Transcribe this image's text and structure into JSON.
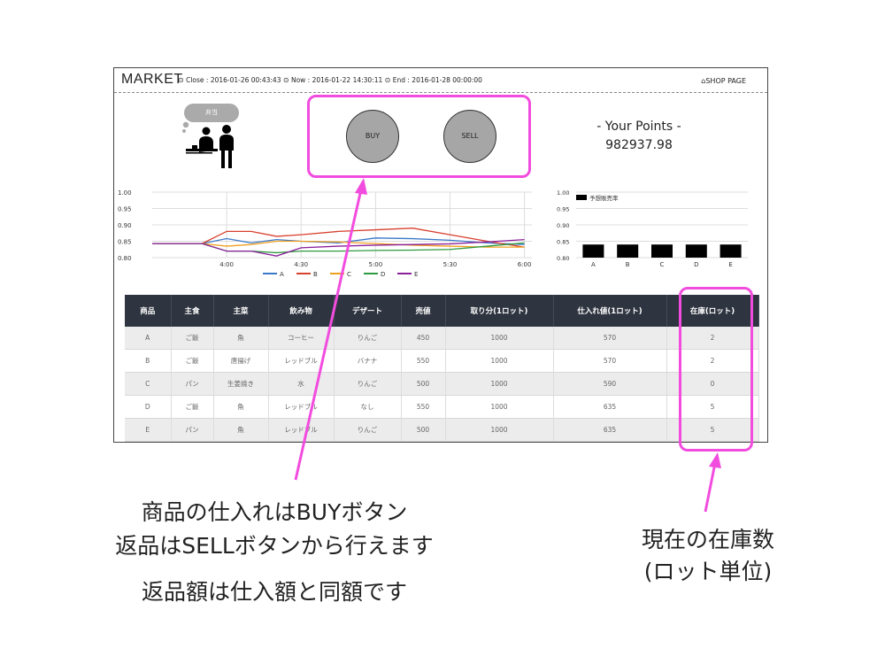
{
  "header": {
    "brand": "MARKET",
    "close": "Close : 2016-01-26 00:43:43",
    "now": "Now : 2016-01-22 14:30:11",
    "end": "End : 2016-01-28 00:00:00",
    "shop_link": "SHOP PAGE",
    "shop_icon": "home-icon",
    "clock_icon": "clock-icon"
  },
  "scene": {
    "bubble_text": "弁当"
  },
  "actions": {
    "buy_label": "BUY",
    "sell_label": "SELL"
  },
  "points": {
    "title": "- Your Points -",
    "value": "982937.98"
  },
  "chart_data": [
    {
      "type": "line",
      "x_ticks": [
        "4:00",
        "4:30",
        "5:00",
        "5:30",
        "6:00"
      ],
      "y_ticks": [
        "0.80",
        "0.85",
        "0.90",
        "0.95",
        "1.00"
      ],
      "ylim": [
        0.8,
        1.0
      ],
      "grid": true,
      "legend": "bottom",
      "x": [
        0,
        0.33,
        0.5,
        0.67,
        1.0,
        1.33,
        1.67,
        2.0,
        2.5,
        3.0,
        3.5,
        4.0,
        4.5,
        5.0
      ],
      "series": [
        {
          "name": "A",
          "color": "#3a78c8",
          "values": [
            0.843,
            0.843,
            0.843,
            0.843,
            0.858,
            0.845,
            0.855,
            0.85,
            0.845,
            0.86,
            0.858,
            0.853,
            0.845,
            0.84
          ]
        },
        {
          "name": "B",
          "color": "#d8402e",
          "values": [
            0.843,
            0.843,
            0.843,
            0.843,
            0.88,
            0.88,
            0.865,
            0.87,
            0.88,
            0.885,
            0.89,
            0.87,
            0.85,
            0.832
          ]
        },
        {
          "name": "C",
          "color": "#f0a020",
          "values": [
            0.843,
            0.843,
            0.843,
            0.843,
            0.835,
            0.84,
            0.85,
            0.85,
            0.848,
            0.843,
            0.838,
            0.835,
            0.832,
            0.832
          ]
        },
        {
          "name": "D",
          "color": "#2e9a40",
          "values": [
            0.843,
            0.843,
            0.843,
            0.843,
            0.82,
            0.82,
            0.815,
            0.82,
            0.82,
            0.822,
            0.823,
            0.825,
            0.835,
            0.845
          ]
        },
        {
          "name": "E",
          "color": "#8a1f9a",
          "values": [
            0.843,
            0.843,
            0.843,
            0.843,
            0.82,
            0.82,
            0.805,
            0.83,
            0.835,
            0.838,
            0.84,
            0.842,
            0.848,
            0.855
          ]
        }
      ]
    },
    {
      "type": "bar",
      "categories": [
        "A",
        "B",
        "C",
        "D",
        "E"
      ],
      "values": [
        0.84,
        0.84,
        0.84,
        0.84,
        0.84
      ],
      "y_ticks": [
        "0.80",
        "0.85",
        "0.90",
        "0.95",
        "1.00"
      ],
      "ylim": [
        0.8,
        1.0
      ],
      "legend_label": "予想販売率",
      "color": "#000000"
    }
  ],
  "table": {
    "headers": [
      "商品",
      "主食",
      "主菜",
      "飲み物",
      "デザート",
      "売値",
      "取り分(1ロット)",
      "仕入れ値(1ロット)",
      "在庫(ロット)"
    ],
    "rows": [
      [
        "A",
        "ご飯",
        "魚",
        "コーヒー",
        "りんご",
        "450",
        "1000",
        "570",
        "2"
      ],
      [
        "B",
        "ご飯",
        "唐揚げ",
        "レッドブル",
        "バナナ",
        "550",
        "1000",
        "570",
        "2"
      ],
      [
        "C",
        "パン",
        "生姜焼き",
        "水",
        "りんご",
        "500",
        "1000",
        "590",
        "0"
      ],
      [
        "D",
        "ご飯",
        "魚",
        "レッドブル",
        "なし",
        "550",
        "1000",
        "635",
        "5"
      ],
      [
        "E",
        "パン",
        "魚",
        "レッドブル",
        "りんご",
        "500",
        "1000",
        "635",
        "5"
      ]
    ]
  },
  "annotations": {
    "left_line1": "商品の仕入れはBUYボタン",
    "left_line2": "返品はSELLボタンから行えます",
    "left_line3": "返品額は仕入額と同額です",
    "right_line1": "現在の在庫数",
    "right_line2": "(ロット単位)",
    "highlight_color": "#f24cdf"
  }
}
